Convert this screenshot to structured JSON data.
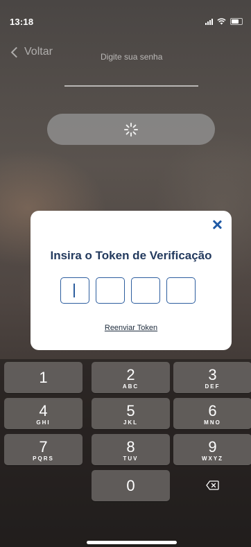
{
  "status_bar": {
    "time": "13:18"
  },
  "nav": {
    "back_label": "Voltar"
  },
  "login": {
    "password_label": "Digite sua senha"
  },
  "modal": {
    "title": "Insira o Token de Verificação",
    "resend_label": "Reenviar Token",
    "token_values": [
      "",
      "",
      "",
      ""
    ]
  },
  "keypad": {
    "keys": [
      {
        "num": "1",
        "letters": ""
      },
      {
        "num": "2",
        "letters": "ABC"
      },
      {
        "num": "3",
        "letters": "DEF"
      },
      {
        "num": "4",
        "letters": "GHI"
      },
      {
        "num": "5",
        "letters": "JKL"
      },
      {
        "num": "6",
        "letters": "MNO"
      },
      {
        "num": "7",
        "letters": "PQRS"
      },
      {
        "num": "8",
        "letters": "TUV"
      },
      {
        "num": "9",
        "letters": "WXYZ"
      },
      {
        "num": "0",
        "letters": ""
      }
    ]
  },
  "colors": {
    "accent": "#2c5d9e",
    "title": "#233a5e"
  }
}
